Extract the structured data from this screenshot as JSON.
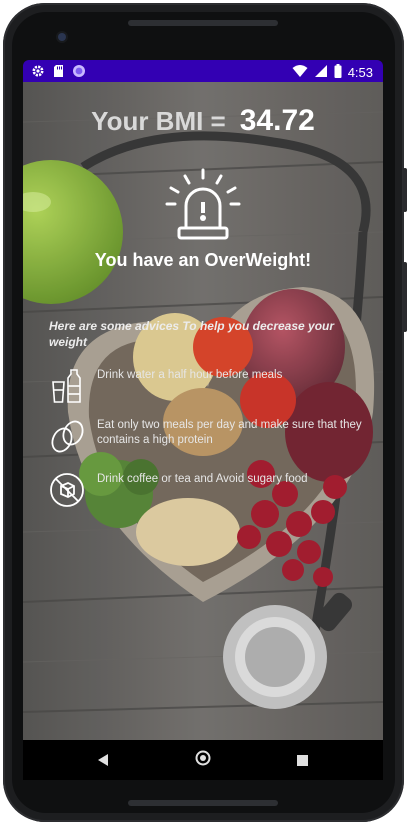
{
  "status_bar": {
    "time": "4:53",
    "left_icons": [
      "gear-icon",
      "sd-card-icon",
      "circle-icon"
    ],
    "right_icons": [
      "wifi-icon",
      "cell-signal-icon",
      "battery-icon"
    ],
    "background_color": "#3300b3"
  },
  "result": {
    "bmi_label": "Your BMI =",
    "bmi_value": "34.72",
    "status_message": "You have an OverWeight!"
  },
  "advice": {
    "title": "Here are some advices To help you decrease your weight",
    "items": [
      {
        "icon": "water-bottle-icon",
        "text": "Drink water a half hour before meals"
      },
      {
        "icon": "eggs-icon",
        "text": "Eat only two meals per day and make sure that they contains a high protein"
      },
      {
        "icon": "no-sugar-icon",
        "text": "Drink coffee or tea and Avoid sugary food"
      }
    ]
  },
  "nav_bar": {
    "buttons": [
      "back-icon",
      "home-icon",
      "recents-icon"
    ]
  },
  "colors": {
    "accent": "#3300b3",
    "text_primary": "#ffffff",
    "text_muted": "#d9d9d9"
  }
}
